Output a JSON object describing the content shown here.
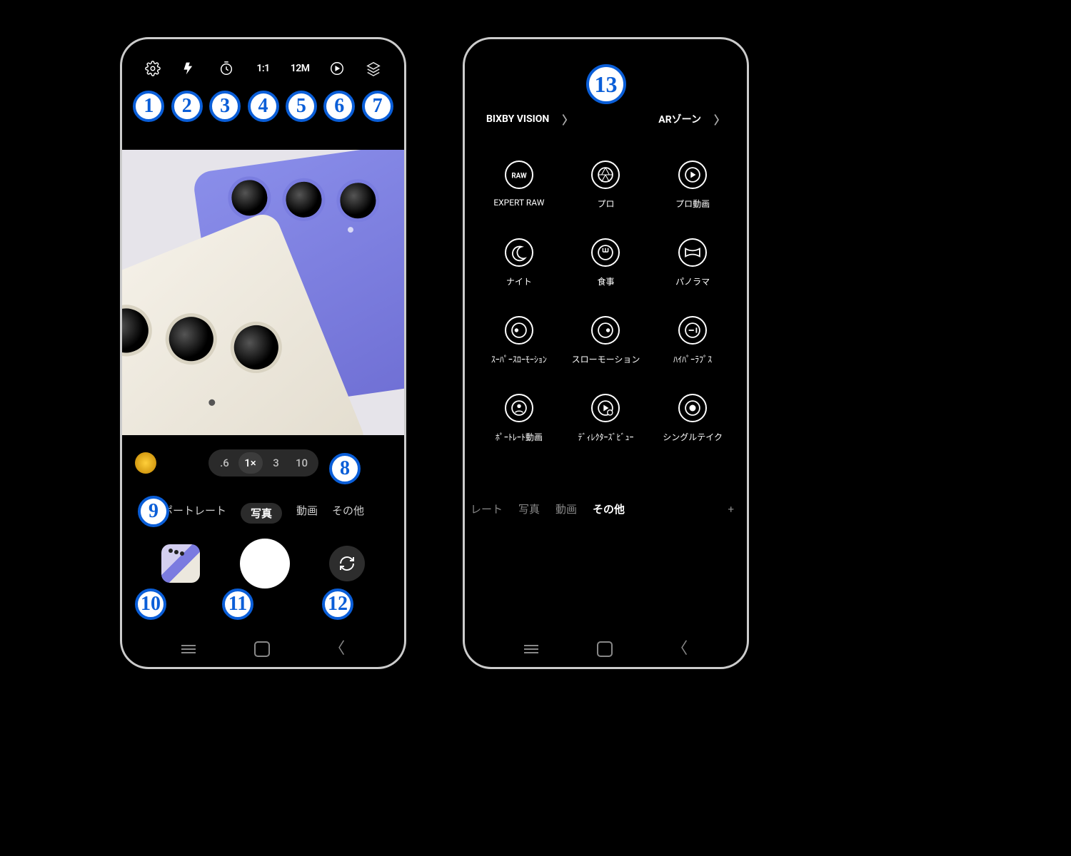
{
  "left": {
    "toolbar": {
      "ratio": "1:1",
      "resolution": "12M"
    },
    "badges": [
      "1",
      "2",
      "3",
      "4",
      "5",
      "6",
      "7",
      "8",
      "9",
      "10",
      "11",
      "12"
    ],
    "zoom": {
      "opts": [
        ".6",
        "1×",
        "3",
        "10"
      ],
      "selected": 1
    },
    "modes": {
      "items": [
        "ポートレート",
        "写真",
        "動画",
        "その他"
      ],
      "selected": 1
    }
  },
  "right": {
    "badge": "13",
    "top": {
      "bixby": "BIXBY VISION",
      "arzone": "ARゾーン"
    },
    "grid": [
      {
        "icon": "raw",
        "label": "EXPERT RAW"
      },
      {
        "icon": "aperture",
        "label": "プロ"
      },
      {
        "icon": "play",
        "label": "プロ動画"
      },
      {
        "icon": "moon",
        "label": "ナイト"
      },
      {
        "icon": "food",
        "label": "食事"
      },
      {
        "icon": "pano",
        "label": "パノラマ"
      },
      {
        "icon": "sslo",
        "label": "ｽｰﾊﾟｰｽﾛｰﾓｰｼｮﾝ"
      },
      {
        "icon": "slo",
        "label": "スローモーション"
      },
      {
        "icon": "hyper",
        "label": "ﾊｲﾊﾟｰﾗﾌﾟｽ"
      },
      {
        "icon": "pvid",
        "label": "ﾎﾟｰﾄﾚｰﾄ動画"
      },
      {
        "icon": "dview",
        "label": "ﾃﾞｨﾚｸﾀｰｽﾞﾋﾞｭｰ"
      },
      {
        "icon": "single",
        "label": "シングルテイク"
      }
    ],
    "modes": {
      "items": [
        "レート",
        "写真",
        "動画",
        "その他"
      ],
      "selected": 3
    },
    "plus": "+"
  }
}
